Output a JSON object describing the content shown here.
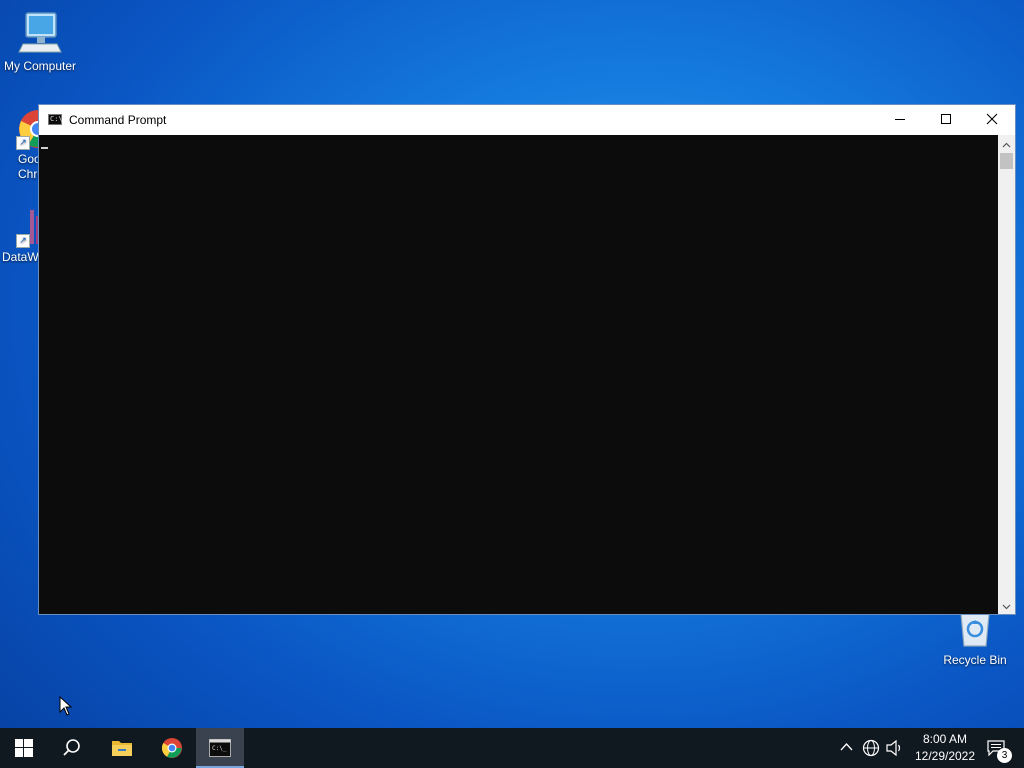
{
  "desktop": {
    "icons": [
      {
        "label": "My Computer"
      },
      {
        "label": "Goo\nChro"
      },
      {
        "label": "DataW"
      },
      {
        "label": "Recycle Bin"
      }
    ]
  },
  "window": {
    "title": "Command Prompt",
    "icon": "cmd-icon",
    "controls": [
      "minimize-icon",
      "maximize-icon",
      "close-icon"
    ]
  },
  "taskbar": {
    "items": [
      "windows-start-icon",
      "search-icon",
      "file-explorer-icon",
      "chrome-icon",
      "cmd-icon"
    ],
    "active_item": "cmd-icon",
    "tray": {
      "icons": [
        "chevron-up-icon",
        "network-globe-icon",
        "volume-icon"
      ],
      "time": "8:00 AM",
      "date": "12/29/2022",
      "notification_count": "3"
    }
  },
  "colors": {
    "console_bg": "#0c0c0c",
    "taskbar_bg": "#101820",
    "desktop_blue": "#1478dc"
  }
}
